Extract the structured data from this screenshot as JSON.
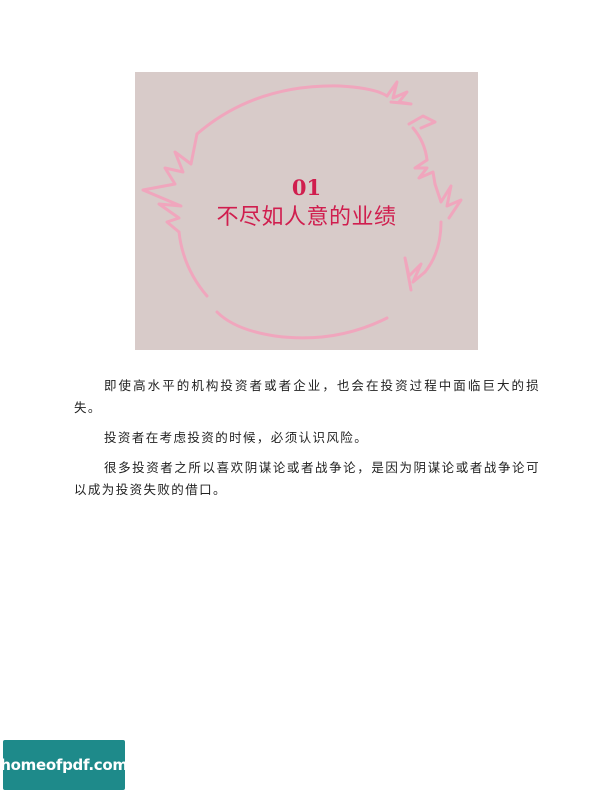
{
  "chapter": {
    "number": "01",
    "title": "不尽如人意的业绩"
  },
  "paragraphs": [
    "即使高水平的机构投资者或者企业，也会在投资过程中面临巨大的损失。",
    "投资者在考虑投资的时候，必须认识风险。",
    "很多投资者之所以喜欢阴谋论或者战争论，是因为阴谋论或者战争论可以成为投资失败的借口。"
  ],
  "watermark": {
    "text": "homeofpdf.com"
  },
  "colors": {
    "accent": "#d01e4e",
    "hero_background": "#d8cbc9",
    "hero_stroke": "#f0a6bd",
    "watermark_background": "#1e8a8a"
  }
}
